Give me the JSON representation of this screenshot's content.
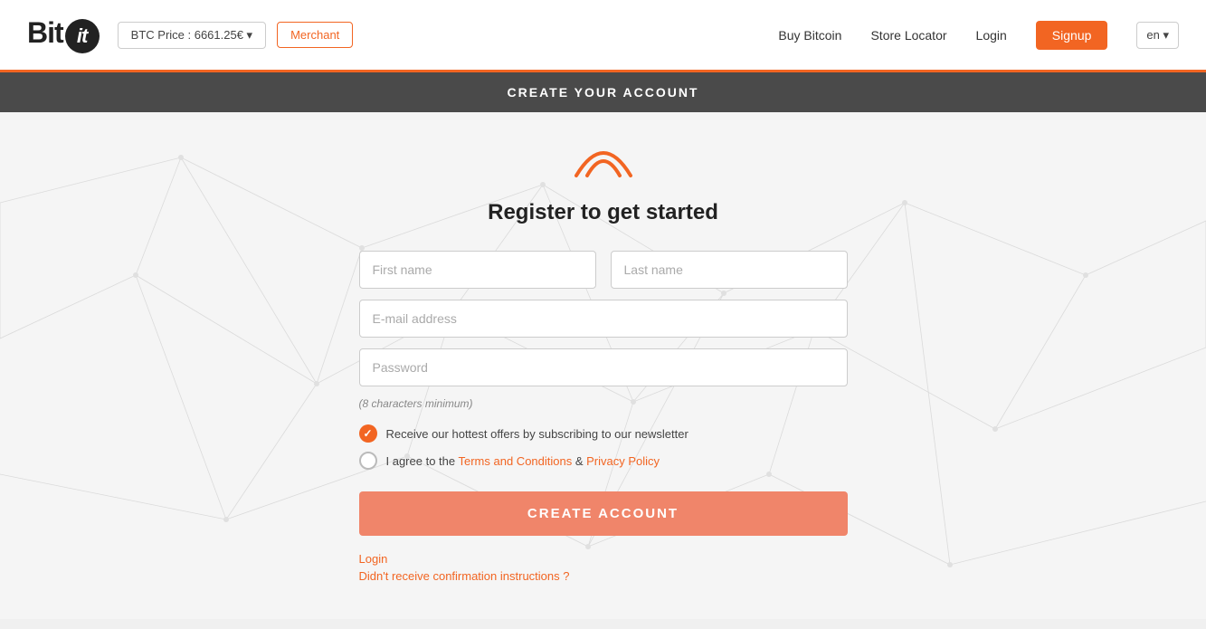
{
  "header": {
    "logo_bit": "Bit",
    "logo_it": "it",
    "btc_price_label": "BTC Price : 6661.25€ ▾",
    "merchant_label": "Merchant",
    "nav": {
      "buy_bitcoin": "Buy Bitcoin",
      "store_locator": "Store Locator",
      "login": "Login",
      "signup": "Signup",
      "lang": "en ▾"
    }
  },
  "sub_header": {
    "title": "CREATE YOUR ACCOUNT"
  },
  "form": {
    "heading_normal": "Register to get ",
    "heading_bold": "started",
    "first_name_placeholder": "First name",
    "last_name_placeholder": "Last name",
    "email_placeholder": "E-mail address",
    "password_placeholder": "Password",
    "password_hint": "(8 characters minimum)",
    "newsletter_label": "Receive our hottest offers by subscribing to our newsletter",
    "terms_label_prefix": "I agree to the ",
    "terms_link": "Terms and Conditions",
    "terms_label_mid": " & ",
    "privacy_link": "Privacy Policy",
    "create_btn": "CREATE ACCOUNT",
    "login_link": "Login",
    "resend_link": "Didn't receive confirmation instructions ?"
  }
}
